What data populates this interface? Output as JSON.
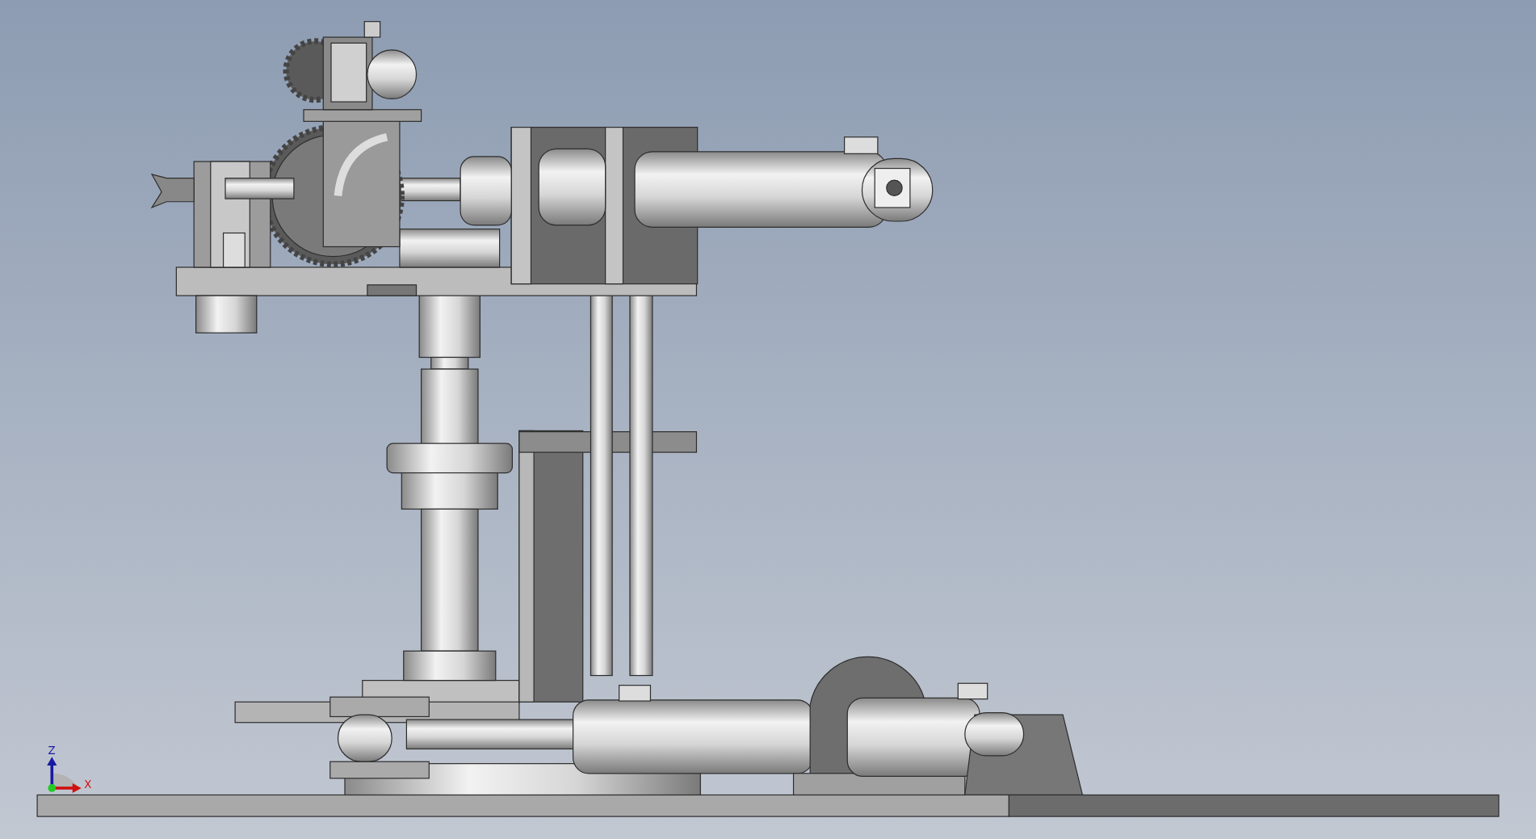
{
  "viewport": {
    "triad": {
      "z_label": "Z",
      "x_label": "X"
    }
  }
}
